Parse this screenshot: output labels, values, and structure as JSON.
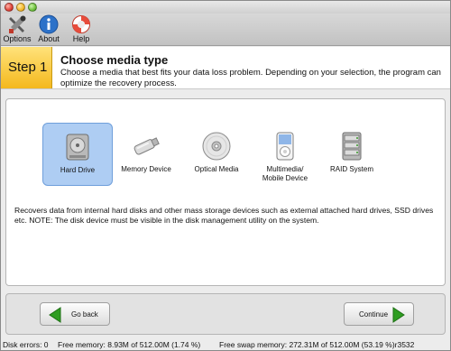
{
  "toolbar": {
    "options_label": "Options",
    "about_label": "About",
    "help_label": "Help"
  },
  "header": {
    "step_label": "Step 1",
    "title": "Choose media type",
    "description": "Choose a media that best fits your data loss problem. Depending on your selection, the program can optimize the recovery process."
  },
  "media_types": [
    {
      "label": "Hard Drive",
      "icon": "hard-drive-icon",
      "selected": true
    },
    {
      "label": "Memory Device",
      "icon": "usb-stick-icon",
      "selected": false
    },
    {
      "label": "Optical Media",
      "icon": "optical-disc-icon",
      "selected": false
    },
    {
      "label": "Multimedia/\nMobile Device",
      "icon": "media-player-icon",
      "selected": false
    },
    {
      "label": "RAID System",
      "icon": "raid-icon",
      "selected": false
    }
  ],
  "media_description": "Recovers data from internal hard disks and other mass storage devices such as external attached hard drives, SSD drives etc. NOTE: The disk device must be visible in the disk management utility on the system.",
  "footer": {
    "back_label": "Go back",
    "continue_label": "Continue"
  },
  "status": {
    "disk_errors": "Disk errors: 0",
    "free_memory": "Free memory: 8.93M of 512.00M (1.74 %)",
    "free_swap": "Free swap memory: 272.31M of 512.00M (53.19 %)r3532"
  },
  "colors": {
    "step_accent": "#f4b81d",
    "selection": "#aecdf3",
    "arrow_green": "#2f9d22"
  }
}
